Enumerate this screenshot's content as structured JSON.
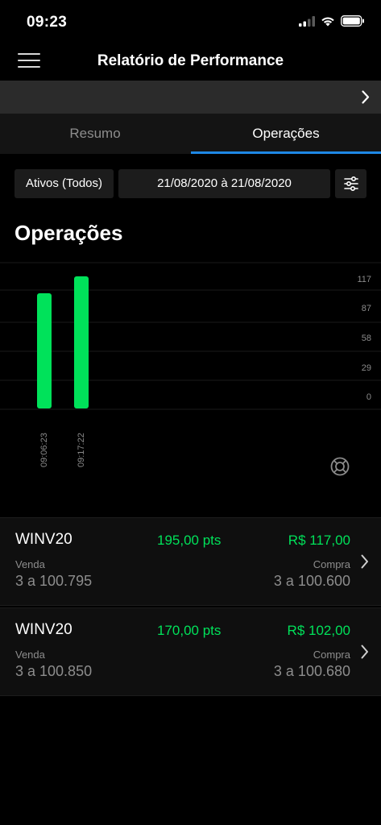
{
  "status_bar": {
    "time": "09:23"
  },
  "header": {
    "title": "Relatório de Performance"
  },
  "tabs": [
    {
      "label": "Resumo",
      "active": false
    },
    {
      "label": "Operações",
      "active": true
    }
  ],
  "filters": {
    "assets": "Ativos (Todos)",
    "date_range": "21/08/2020 à 21/08/2020"
  },
  "section": {
    "title": "Operações"
  },
  "chart_data": {
    "type": "bar",
    "categories": [
      "09:06:23",
      "09:17:22"
    ],
    "values": [
      102,
      117
    ],
    "y_ticks": [
      "117",
      "87",
      "58",
      "29",
      "0"
    ],
    "ylim": [
      0,
      117
    ],
    "bar_color": "#00e25a",
    "grid": true
  },
  "trades": [
    {
      "asset": "WINV20",
      "points": "195,00 pts",
      "result": "R$ 117,00",
      "sell_label": "Venda",
      "sell_value": "3 a 100.795",
      "buy_label": "Compra",
      "buy_value": "3 a 100.600"
    },
    {
      "asset": "WINV20",
      "points": "170,00 pts",
      "result": "R$ 102,00",
      "sell_label": "Venda",
      "sell_value": "3 a 100.850",
      "buy_label": "Compra",
      "buy_value": "3 a 100.680"
    }
  ],
  "colors": {
    "accent": "#1e88e5",
    "positive": "#00e25a",
    "background": "#000000"
  }
}
